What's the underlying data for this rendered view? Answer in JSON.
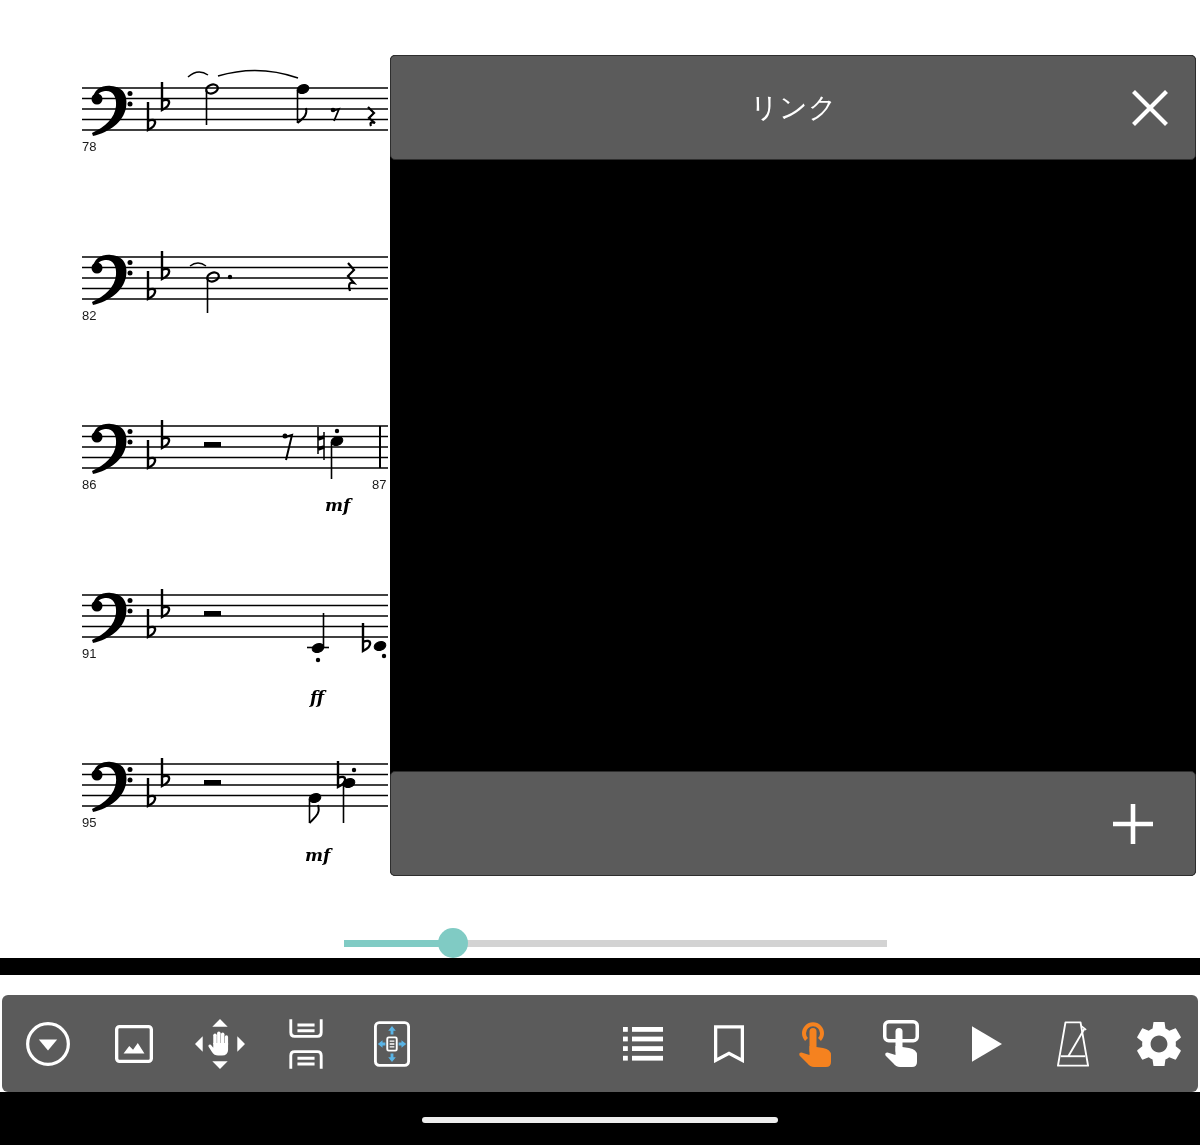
{
  "score": {
    "systems": [
      {
        "measure_numbers": [
          "78"
        ]
      },
      {
        "measure_numbers": [
          "82"
        ]
      },
      {
        "measure_numbers": [
          "86",
          "87"
        ],
        "dynamics": [
          "mf"
        ]
      },
      {
        "measure_numbers": [
          "91"
        ],
        "dynamics": [
          "ff"
        ]
      },
      {
        "measure_numbers": [
          "95"
        ],
        "dynamics": [
          "mf"
        ]
      }
    ]
  },
  "link_dialog": {
    "title": "リンク"
  },
  "page_slider": {
    "level": 0.2
  },
  "toolbar": {
    "left_buttons": [
      {
        "on": false
      },
      {
        "on": false
      },
      {
        "on": false
      },
      {
        "on": false
      },
      {
        "on": false
      }
    ],
    "right_buttons": [
      {
        "on": false
      },
      {
        "on": false
      },
      {
        "on": true
      },
      {
        "on": false
      },
      {
        "on": false
      },
      {
        "on": false
      },
      {
        "on": false
      }
    ]
  }
}
